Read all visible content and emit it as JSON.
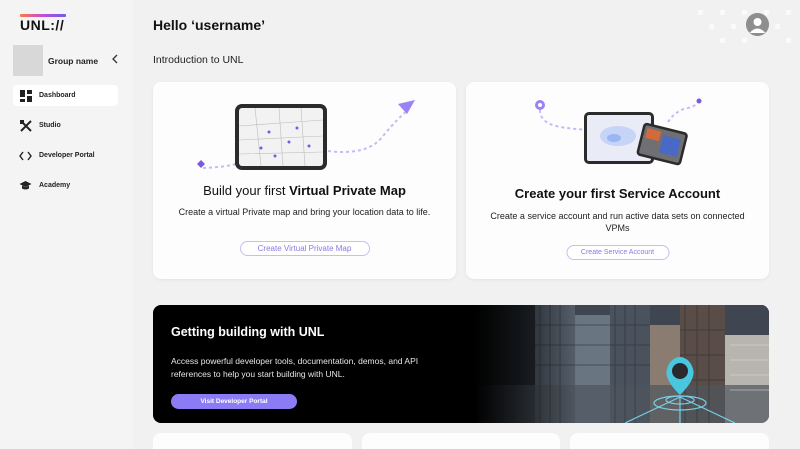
{
  "app": {
    "logo_text": "UNL://"
  },
  "sidebar": {
    "group_name": "Group name",
    "collapse_icon": "chevron-left-icon",
    "items": [
      {
        "label": "Dashboard",
        "icon": "dashboard-icon",
        "active": true
      },
      {
        "label": "Studio",
        "icon": "studio-tools-icon",
        "active": false
      },
      {
        "label": "Developer Portal",
        "icon": "code-icon",
        "active": false
      },
      {
        "label": "Academy",
        "icon": "graduation-cap-icon",
        "active": false
      }
    ]
  },
  "header": {
    "greeting": "Hello ‘username’",
    "avatar_icon": "user-avatar-icon"
  },
  "main": {
    "intro_title": "Introduction to UNL",
    "cards": [
      {
        "title_prefix": "Build your first ",
        "title_bold": "Virtual Private Map",
        "description": "Create a virtual Private map and bring your location data to life.",
        "button": "Create Virtual Private Map"
      },
      {
        "title_prefix": "",
        "title_bold": "Create your first Service Account",
        "description": "Create a service account and run active data sets on connected VPMs",
        "button": "Create Service Account"
      }
    ],
    "banner": {
      "title": "Getting building with UNL",
      "text": "Access powerful developer tools, documentation, demos, and API references to help you start building with UNL.",
      "button": "Visit Developer Portal"
    }
  },
  "colors": {
    "accent": "#8b7cf5",
    "accent_outline": "#c8bdf0",
    "background": "#f1f1f1",
    "card": "#fdfdfe",
    "banner": "#000000"
  }
}
